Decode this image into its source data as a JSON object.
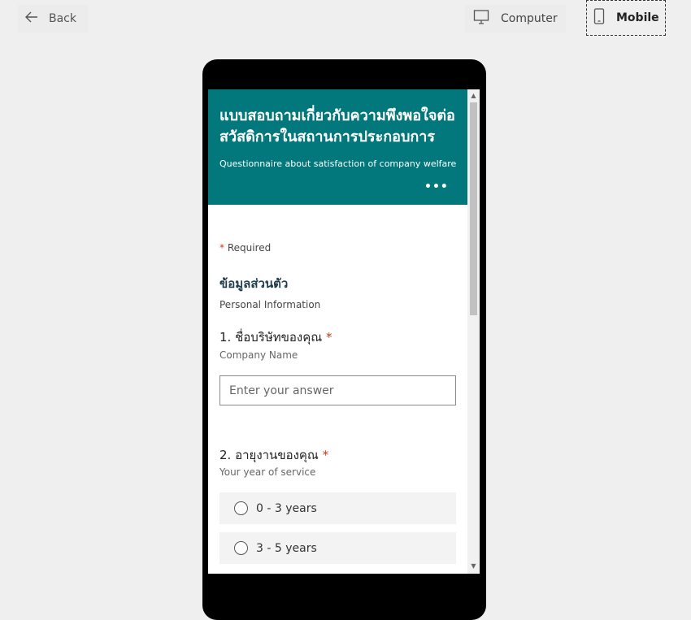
{
  "topbar": {
    "back_label": "Back",
    "computer_label": "Computer",
    "mobile_label": "Mobile"
  },
  "form": {
    "title": "แบบสอบถามเกี่ยวกับความพึงพอใจต่อสวัสดิการในสถานการประกอบการ",
    "subtitle": "Questionnaire about satisfaction of company welfare",
    "more_label": "•••",
    "header_color": "#03787c",
    "required_star": "*",
    "required_label": "Required",
    "section_title": "ข้อมูลส่วนตัว",
    "section_subtitle": "Personal Information",
    "questions": [
      {
        "number": "1.",
        "title": "ชื่อบริษัทของคุณ",
        "subtitle": "Company Name",
        "placeholder": "Enter your answer"
      },
      {
        "number": "2.",
        "title": "อายุงานของคุณ",
        "subtitle": "Your year of service",
        "options": [
          "0 - 3 years",
          "3 - 5 years"
        ]
      }
    ]
  },
  "icons": {
    "back": "arrow-left-icon",
    "computer": "monitor-icon",
    "mobile": "phone-icon"
  }
}
